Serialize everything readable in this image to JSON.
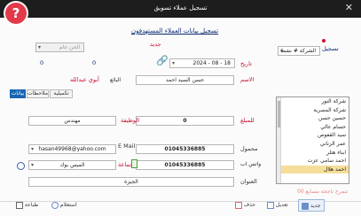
{
  "window": {
    "title": "تسجيل عملاء تسويق",
    "close": "✕",
    "logo_glyph": "?"
  },
  "search": {
    "label": "تسجيل"
  },
  "company_filter": {
    "value": "الشركة # نشط"
  },
  "heading": "تسجيل بيانات العملاء المستهدفون",
  "new_badge": "جديد",
  "counter": "0",
  "date": {
    "label": "تاريخ",
    "value": "2024 - 08 - 18"
  },
  "status_select": {
    "value": "الحن عام"
  },
  "status_value": "0",
  "fields": {
    "name_label": "الاسم",
    "name_value": "حسن السيد احمد",
    "rep_label": "البائع",
    "rep_value": "أبوي عبدالله",
    "balance_label": "للمبلغ",
    "balance_value": "0",
    "job_label": "الوظيفة",
    "job_value": "مهندس",
    "mobile_label": "محمول",
    "mobile_value": "01045336885",
    "email_label": "E Mail",
    "email_value": "hasan49968@yahoo.com",
    "whatsapp_label": "واتس اب",
    "whatsapp_value": "01045336885",
    "activity_label": "الجماعة",
    "activity_value": "الميس بوك",
    "address_label": "العنوان",
    "address_value": "الجيزة"
  },
  "tabs": [
    "بيانات",
    "ملاحظات",
    "تكميلية"
  ],
  "customers": [
    "شركة النور",
    "شركة المصرية",
    "حسين حسن",
    "حسام عالي",
    "سيد القفوص",
    "عمر الزناني",
    "ابناء هتلر",
    "احمد سامي عزت",
    "احمد هلال"
  ],
  "selected_customer": "احمد هلال",
  "footer_hint": "تنمرح ناجحة مسابع 00",
  "buttons": {
    "new": "جديد",
    "edit": "تعديل",
    "delete": "حذف",
    "query": "استعلام",
    "print": "طباعة"
  },
  "colors": {
    "title_bar": "#1d1d1d",
    "label_red": "#c8102e",
    "label_green": "#4c9c3a",
    "tab_active": "#1a66b3",
    "list_selected": "#f5de9a"
  }
}
